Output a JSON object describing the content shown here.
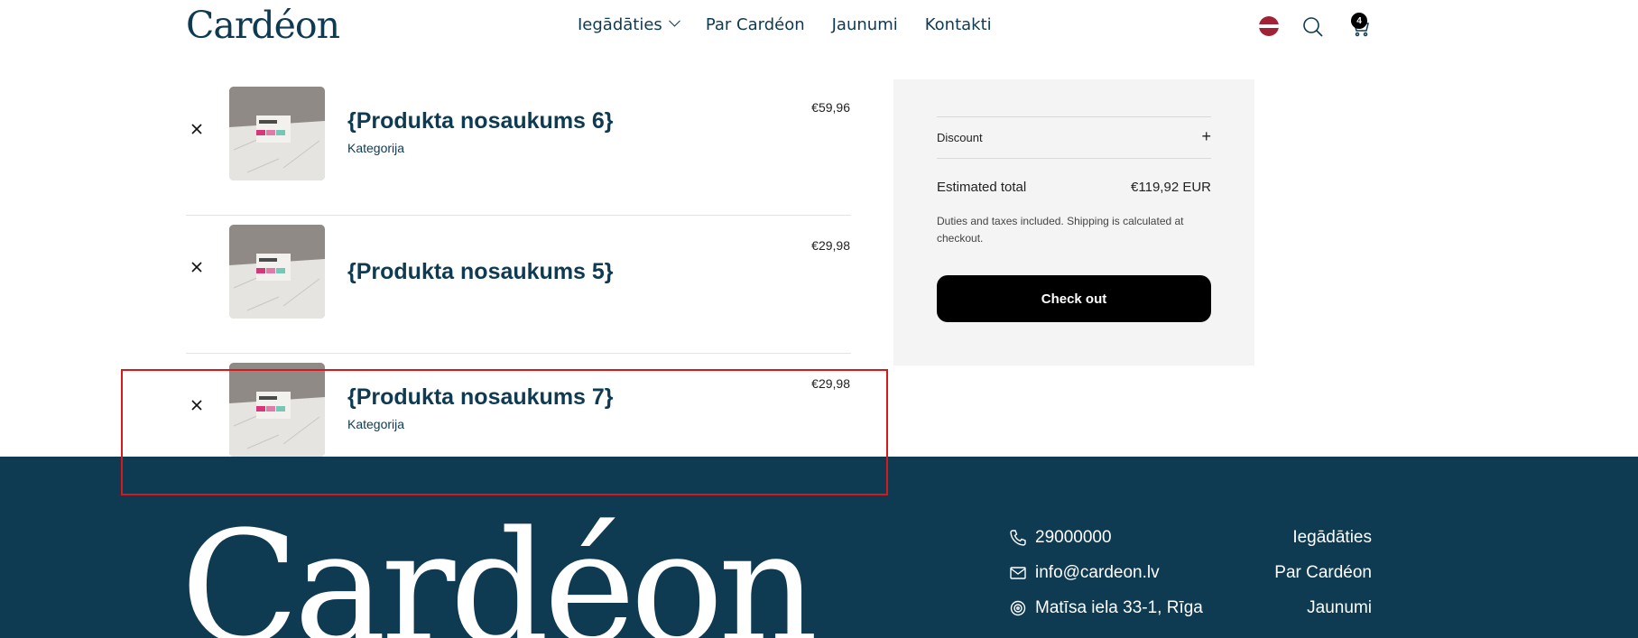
{
  "header": {
    "logo": "Cardéon",
    "nav": [
      {
        "label": "Iegādāties",
        "has_dropdown": true
      },
      {
        "label": "Par Cardéon"
      },
      {
        "label": "Jaunumi"
      },
      {
        "label": "Kontakti"
      }
    ],
    "cart_count": "4",
    "icons": [
      "latvia-flag-icon",
      "search-icon",
      "cart-icon"
    ]
  },
  "cart": {
    "items": [
      {
        "name": "{Produkta nosaukums 6}",
        "category": "Kategorija",
        "price": "€59,96"
      },
      {
        "name": "{Produkta nosaukums 5}",
        "category": "",
        "price": "€29,98"
      },
      {
        "name": "{Produkta nosaukums 7}",
        "category": "Kategorija",
        "price": "€29,98"
      }
    ]
  },
  "summary": {
    "discount_label": "Discount",
    "total_label": "Estimated total",
    "total_value": "€119,92 EUR",
    "note": "Duties and taxes included. Shipping is calculated at checkout.",
    "checkout_label": "Check out"
  },
  "footer": {
    "logo": "Cardéon",
    "phone": "29000000",
    "email": "info@cardeon.lv",
    "address": "Matīsa iela 33-1, Rīga",
    "links": [
      "Iegādāties",
      "Par Cardéon",
      "Jaunumi"
    ]
  },
  "colors": {
    "brand": "#0e3a52",
    "footer_bg": "#0e3a52",
    "summary_bg": "#f4f4f4",
    "button_bg": "#000000",
    "highlight": "#d7191c"
  }
}
